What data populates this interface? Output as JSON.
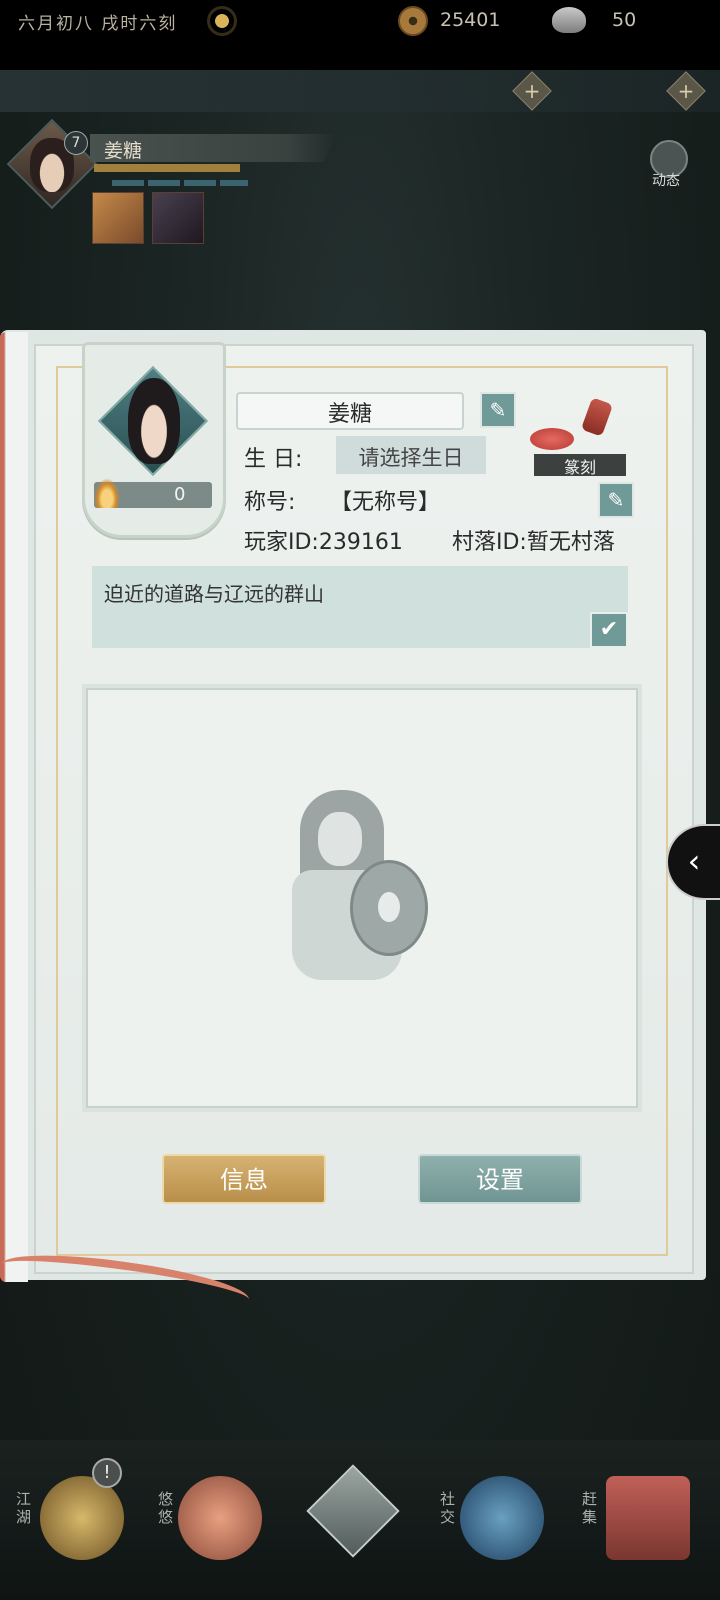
{
  "top_bar": {
    "date": "六月初八  戌时六刻",
    "coins": "25401",
    "ingots": "50",
    "plus": "+"
  },
  "character": {
    "level": "7",
    "name": "姜糖",
    "dynamic_label": "动态"
  },
  "profile": {
    "name": "姜糖",
    "birthday_label": "生  日:",
    "birthday_value": "请选择生日",
    "title_label": "称号:",
    "title_value": "【无称号】",
    "player_id": "玩家ID:239161",
    "village_id": "村落ID:暂无村落",
    "seal_label": "篆刻",
    "portrait_count": "0",
    "motto": "迫近的道路与辽远的群山",
    "edit_glyph": "✎",
    "check_glyph": "✔"
  },
  "buttons": {
    "info": "信息",
    "settings": "设置",
    "side_arrow": "‹"
  },
  "bottom_nav": {
    "alert": "!",
    "items": [
      {
        "label": "江湖",
        "icon": "jianghu-icon"
      },
      {
        "label": "悠悠",
        "icon": "youyou-icon"
      },
      {
        "label": "",
        "icon": "compass-star-icon"
      },
      {
        "label": "社交",
        "icon": "social-icon"
      },
      {
        "label": "赶集",
        "icon": "market-icon"
      }
    ]
  },
  "colors": {
    "accent_teal": "#6f9a98",
    "gold_button": "#c9a25e",
    "page_bg": "#eef2ef"
  }
}
